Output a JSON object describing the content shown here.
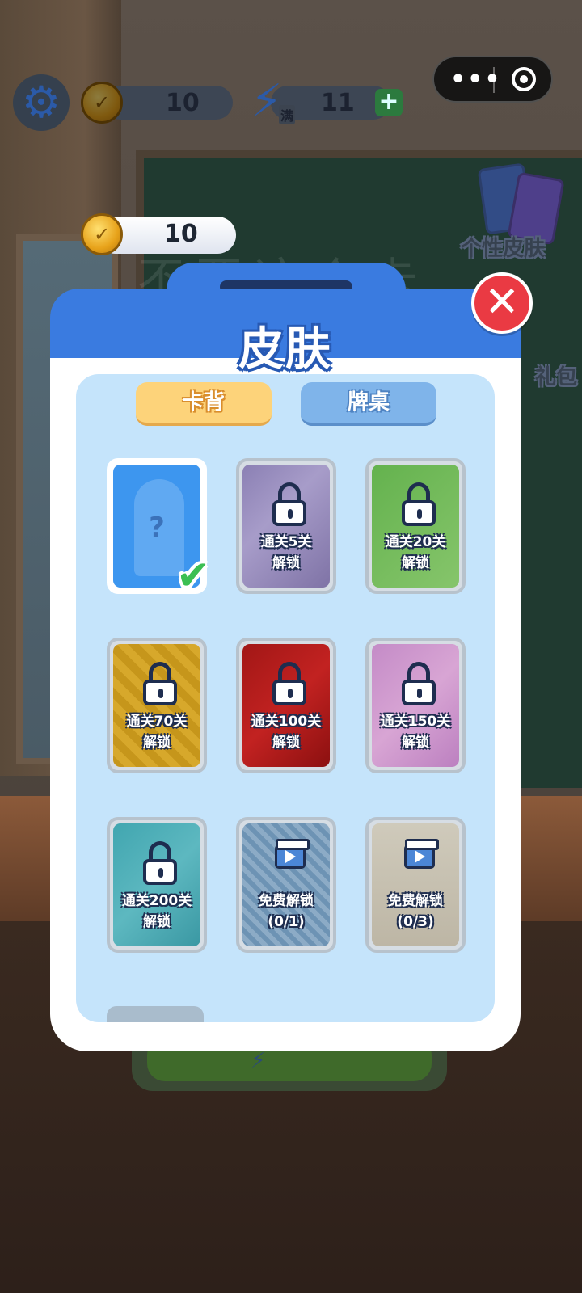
{
  "topbar": {
    "coins": "10",
    "energy": "11",
    "energy_tag": "满",
    "plus": "+"
  },
  "capsule": {
    "more": "•••"
  },
  "side": {
    "skin_label": "个性皮肤",
    "gift_label": "礼包"
  },
  "background_text": "不要这个卡",
  "coin_display": {
    "value": "10"
  },
  "dialog": {
    "title": "皮肤",
    "close": "✕",
    "tabs": [
      {
        "label": "卡背",
        "active": true
      },
      {
        "label": "牌桌",
        "active": false
      }
    ],
    "cards": [
      {
        "id": "default",
        "selected": true,
        "line1": "",
        "line2": ""
      },
      {
        "id": "purple",
        "locked": true,
        "line1": "通关5关",
        "line2": "解锁"
      },
      {
        "id": "green",
        "locked": true,
        "line1": "通关20关",
        "line2": "解锁"
      },
      {
        "id": "yellow",
        "locked": true,
        "line1": "通关70关",
        "line2": "解锁"
      },
      {
        "id": "red",
        "locked": true,
        "line1": "通关100关",
        "line2": "解锁"
      },
      {
        "id": "pink",
        "locked": true,
        "line1": "通关150关",
        "line2": "解锁"
      },
      {
        "id": "teal",
        "locked": true,
        "line1": "通关200关",
        "line2": "解锁"
      },
      {
        "id": "navy",
        "video": true,
        "line1": "免费解锁",
        "line2": "(0/1)"
      },
      {
        "id": "beige",
        "video": true,
        "line1": "免费解锁",
        "line2": "(0/3)"
      }
    ]
  },
  "colors": {
    "header": "#3a7be0",
    "panel": "#c5e4fb",
    "close": "#ea3a43",
    "tab_active": "#fdd37a",
    "tab_inactive": "#7fb4ea"
  }
}
